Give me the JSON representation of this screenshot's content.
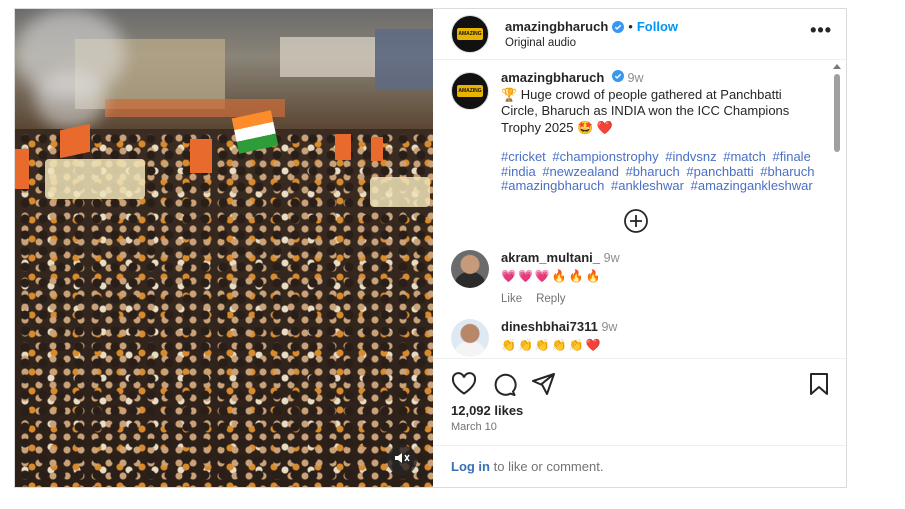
{
  "post": {
    "author": "amazingbharuch",
    "follow_label": "Follow",
    "dot": "•",
    "audio": "Original audio",
    "more_label": "•••"
  },
  "caption": {
    "username": "amazingbharuch",
    "time": "9w",
    "text": "🏆 Huge crowd of people gathered at Panchbatti Circle, Bharuch as INDIA won the ICC Champions Trophy 2025 🤩 ❤️",
    "hashtags": [
      "#cricket",
      "#championstrophy",
      "#indvsnz",
      "#match",
      "#finale",
      "#india",
      "#newzealand",
      "#bharuch",
      "#panchbatti",
      "#bharuch",
      "#amazingbharuch",
      "#ankleshwar",
      "#amazingankleshwar"
    ]
  },
  "comments": [
    {
      "username": "akram_multani_",
      "time": "9w",
      "text": "💗💗💗🔥🔥🔥",
      "like_label": "Like",
      "reply_label": "Reply"
    },
    {
      "username": "dineshbhai7311",
      "time": "9w",
      "text": "👏👏👏👏👏❤️"
    }
  ],
  "stats": {
    "likes": "12,092 likes",
    "date": "March 10"
  },
  "login": {
    "link": "Log in",
    "rest": " to like or comment."
  },
  "colors": {
    "accent": "#0095f6",
    "hashtag": "#4a6fc4",
    "like_red": "#ed4956"
  },
  "icons": {
    "like": "heart-icon",
    "comment": "comment-bubble-icon",
    "share": "paper-plane-icon",
    "save": "bookmark-icon",
    "mute": "speaker-muted-icon",
    "verified": "verified-badge-icon",
    "load_more": "plus-circle-icon"
  }
}
